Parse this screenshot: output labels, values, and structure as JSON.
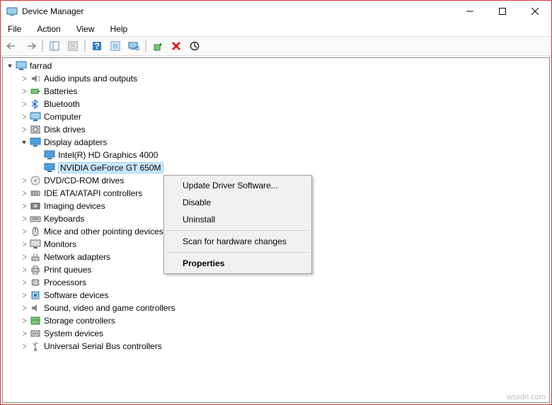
{
  "window": {
    "title": "Device Manager"
  },
  "menu": {
    "file": "File",
    "action": "Action",
    "view": "View",
    "help": "Help"
  },
  "tree": {
    "root": "farrad",
    "items": [
      {
        "label": "Audio inputs and outputs",
        "icon": "audio"
      },
      {
        "label": "Batteries",
        "icon": "battery"
      },
      {
        "label": "Bluetooth",
        "icon": "bluetooth"
      },
      {
        "label": "Computer",
        "icon": "computer"
      },
      {
        "label": "Disk drives",
        "icon": "disk"
      },
      {
        "label": "Display adapters",
        "icon": "display",
        "expanded": true,
        "children": [
          {
            "label": "Intel(R) HD Graphics 4000",
            "icon": "display"
          },
          {
            "label": "NVIDIA GeForce GT 650M",
            "icon": "display",
            "selected": true
          }
        ]
      },
      {
        "label": "DVD/CD-ROM drives",
        "icon": "dvd"
      },
      {
        "label": "IDE ATA/ATAPI controllers",
        "icon": "ide"
      },
      {
        "label": "Imaging devices",
        "icon": "imaging"
      },
      {
        "label": "Keyboards",
        "icon": "keyboard"
      },
      {
        "label": "Mice and other pointing devices",
        "icon": "mouse"
      },
      {
        "label": "Monitors",
        "icon": "monitor"
      },
      {
        "label": "Network adapters",
        "icon": "network"
      },
      {
        "label": "Print queues",
        "icon": "printer"
      },
      {
        "label": "Processors",
        "icon": "cpu"
      },
      {
        "label": "Software devices",
        "icon": "software"
      },
      {
        "label": "Sound, video and game controllers",
        "icon": "sound"
      },
      {
        "label": "Storage controllers",
        "icon": "storage"
      },
      {
        "label": "System devices",
        "icon": "system"
      },
      {
        "label": "Universal Serial Bus controllers",
        "icon": "usb"
      }
    ]
  },
  "context_menu": {
    "update": "Update Driver Software...",
    "disable": "Disable",
    "uninstall": "Uninstall",
    "scan": "Scan for hardware changes",
    "properties": "Properties"
  },
  "watermark": "wsxdn.com"
}
